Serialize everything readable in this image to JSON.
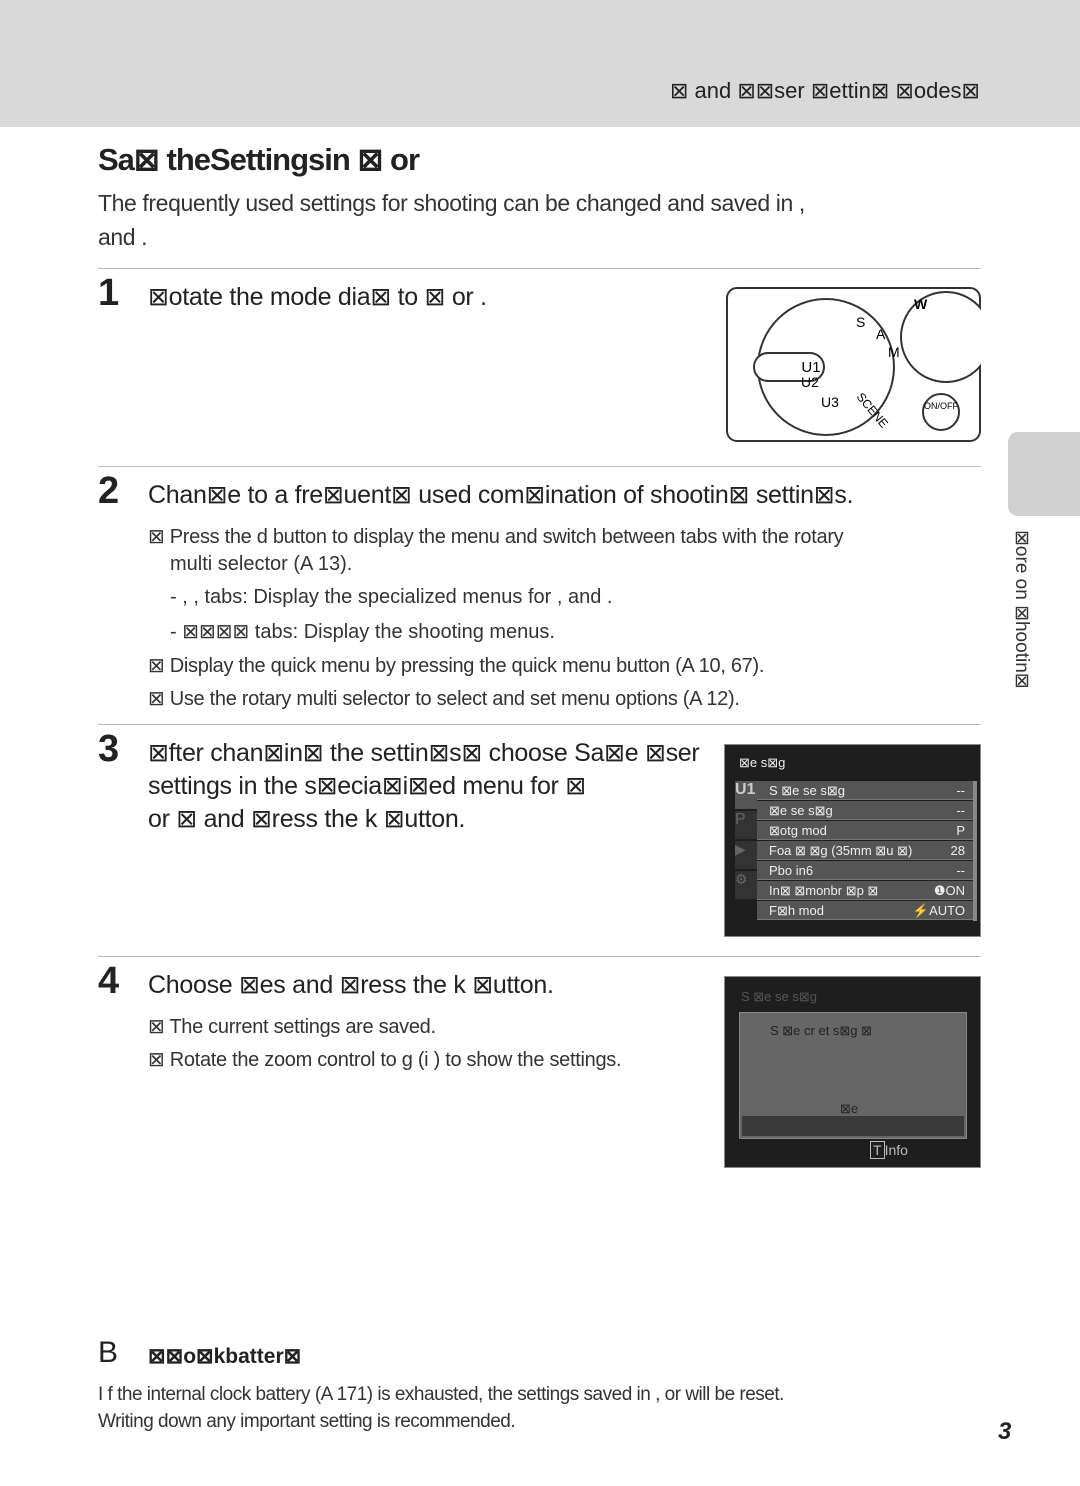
{
  "header": {
    "title": "⊠    and     ⊠⊠ser ⊠ettin⊠ ⊠odes⊠"
  },
  "page": {
    "title": "Sa⊠ theSettingsin        ⊠     or",
    "intro_line1": "The frequently used settings for shooting can be changed and saved in      ,",
    "intro_line2": "and      ."
  },
  "steps": [
    {
      "num": "1",
      "text": "⊠otate the mode dia⊠ to     ⊠      or     ."
    },
    {
      "num": "2",
      "text": "Chan⊠e to a fre⊠uent⊠ used com⊠ination of shootin⊠ settin⊠s.",
      "bullets": [
        "⊠ Press the d     button to display the menu and switch between tabs with the rotary",
        "multi selector (A   13).",
        "-      ,       ,         tabs:  Display the specialized menus for       ,        and       .",
        "- ⊠⊠⊠⊠ tabs:  Display the shooting menus.",
        "⊠ Display the quick menu by pressing the quick menu button (A    10,  67).",
        "⊠ Use the rotary multi selector to select and set menu options (A    12)."
      ]
    },
    {
      "num": "3",
      "lines": [
        "⊠fter chan⊠in⊠ the settin⊠s⊠ choose Sa⊠e ⊠ser",
        "settings in the s⊠ecia⊠i⊠ed menu for      ⊠",
        "or       ⊠ and ⊠ress the k   ⊠utton."
      ]
    },
    {
      "num": "4",
      "text": "Choose ⊠es  and ⊠ress the k   ⊠utton.",
      "bullets": [
        "⊠ The current settings are saved.",
        "⊠ Rotate the zoom control to   g  (i  ) to show the settings."
      ]
    }
  ],
  "dial": {
    "labels": [
      "U1",
      "S",
      "A",
      "M",
      "SCENE",
      "U3",
      "U2",
      "W",
      "ON/OFF"
    ]
  },
  "menu_screen": {
    "title": "⊠e    s⊠g",
    "tabs": [
      "U1",
      "P",
      "▶",
      "⚙"
    ],
    "rows": [
      {
        "label": "S  ⊠e se     s⊠g",
        "value": "--"
      },
      {
        "label": "⊠e      se     s⊠g",
        "value": "--"
      },
      {
        "label": "⊠otg          mod",
        "value": "P"
      },
      {
        "label": "Foa ⊠ ⊠g       (35mm ⊠u  ⊠)",
        "value": "28"
      },
      {
        "label": "Pbo     in6",
        "value": "--"
      },
      {
        "label": "In⊠  ⊠monbr    ⊠p  ⊠",
        "value": "❶ON"
      },
      {
        "label": "F⊠h    mod",
        "value": "⚡AUTO"
      }
    ]
  },
  "confirm_screen": {
    "title": "S  ⊠e se     s⊠g",
    "question": "S  ⊠e cr et        s⊠g        ⊠",
    "option": "⊠e",
    "info": "Info",
    "info_key": "T"
  },
  "side": {
    "label": "⊠ore on ⊠hootin⊠"
  },
  "note": {
    "icon": "B",
    "title": "⊠⊠o⊠kbatter⊠",
    "line1": "I f the internal clock battery (A    171) is exhausted,  the settings saved in       ,          or          will be reset.",
    "line2": "Writing down any important setting is recommended."
  },
  "page_number": "3"
}
